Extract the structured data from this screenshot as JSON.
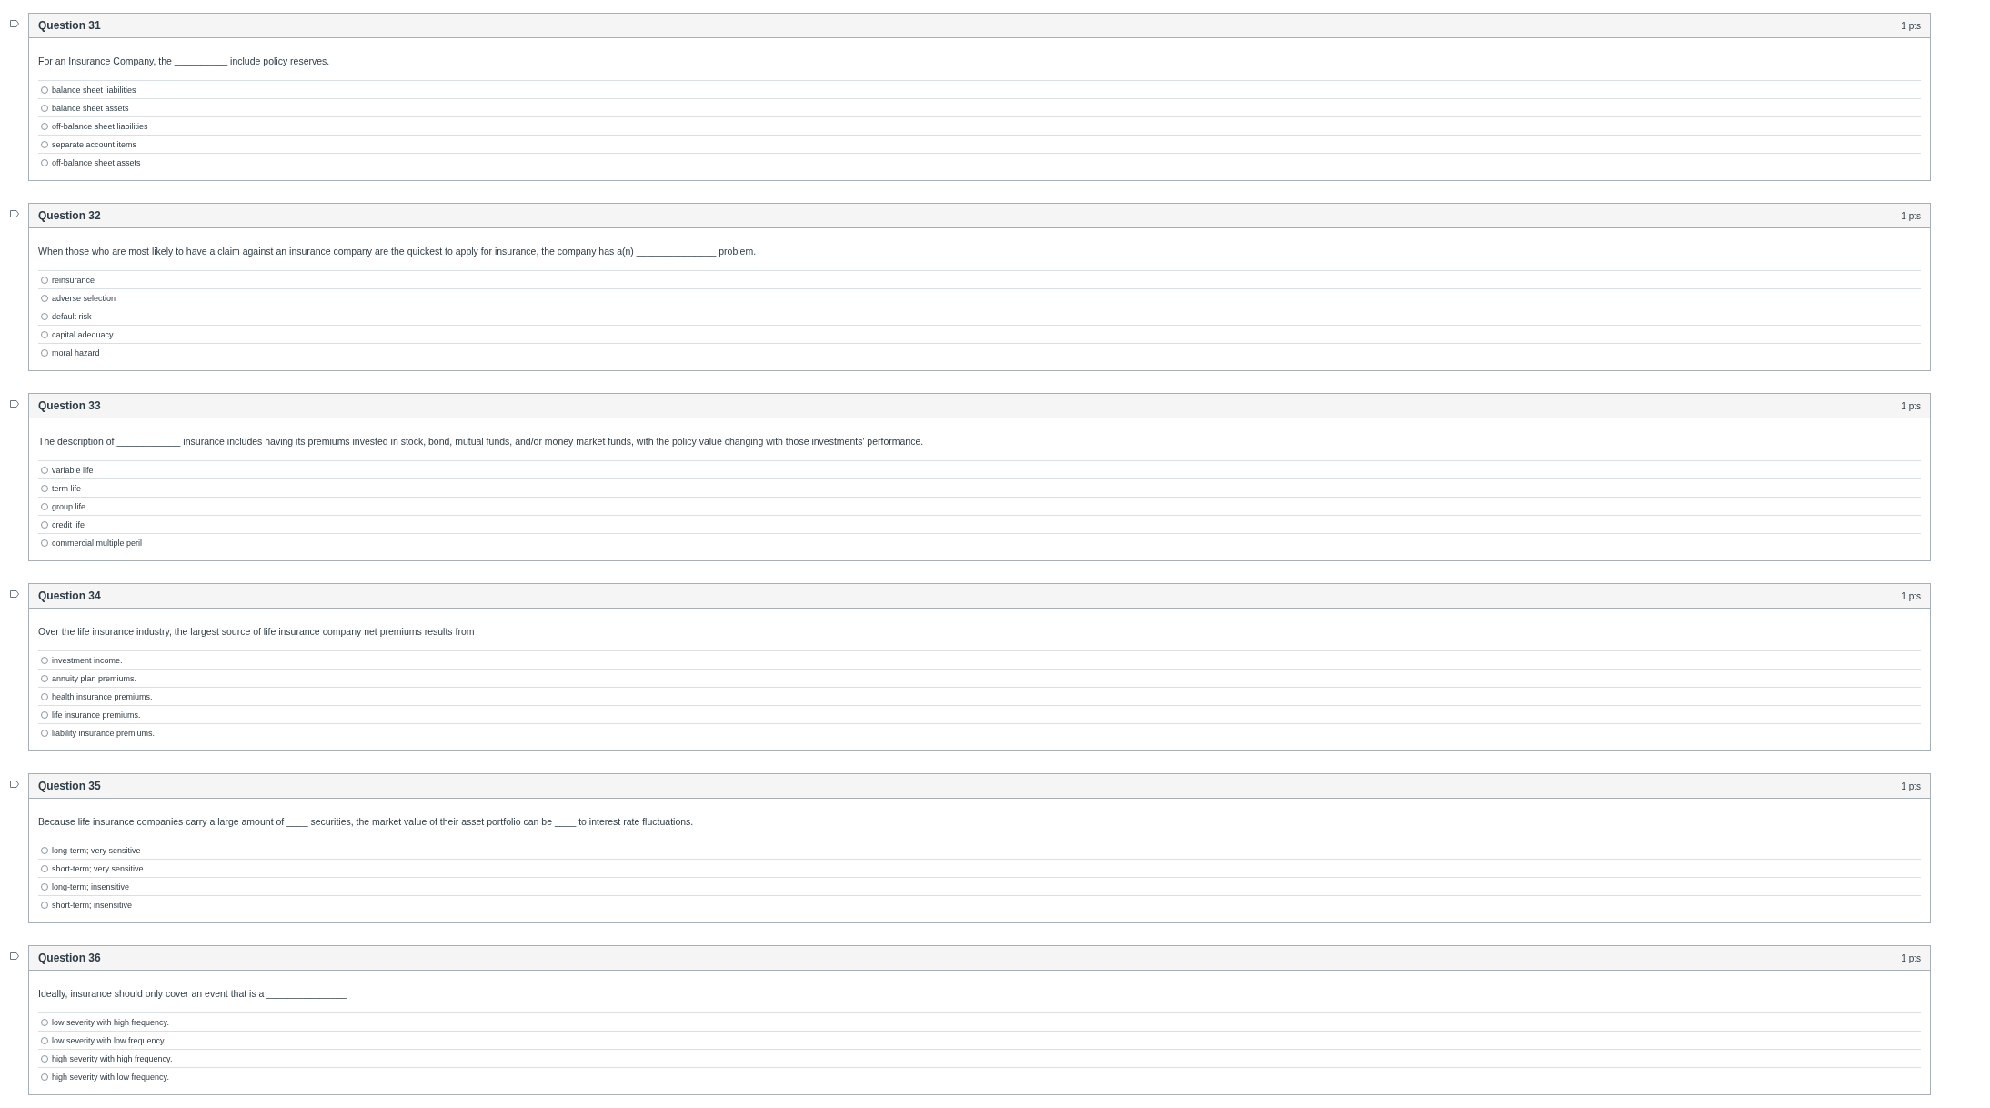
{
  "questions": [
    {
      "title": "Question 31",
      "points": "1 pts",
      "text": "For an Insurance Company, the __________ include policy reserves.",
      "options": [
        {
          "label": "balance sheet liabilities",
          "selected": false
        },
        {
          "label": "balance sheet assets",
          "selected": false
        },
        {
          "label": "off-balance sheet liabilities",
          "selected": false
        },
        {
          "label": "separate account items",
          "selected": false
        },
        {
          "label": "off-balance sheet assets",
          "selected": false
        }
      ]
    },
    {
      "title": "Question 32",
      "points": "1 pts",
      "text": "When those who are most likely to have a claim against an insurance company are the quickest to apply for insurance, the company has a(n) _______________ problem.",
      "options": [
        {
          "label": "reinsurance",
          "selected": false
        },
        {
          "label": "adverse selection",
          "selected": false
        },
        {
          "label": "default risk",
          "selected": false
        },
        {
          "label": "capital adequacy",
          "selected": false
        },
        {
          "label": "moral hazard",
          "selected": false
        }
      ]
    },
    {
      "title": "Question 33",
      "points": "1 pts",
      "text": "The description of ____________ insurance includes having its premiums invested in stock, bond, mutual funds, and/or money market funds, with the policy value changing with those investments' performance.",
      "options": [
        {
          "label": "variable life",
          "selected": false
        },
        {
          "label": "term life",
          "selected": false
        },
        {
          "label": "group life",
          "selected": false
        },
        {
          "label": "credit life",
          "selected": false
        },
        {
          "label": "commercial multiple peril",
          "selected": false
        }
      ]
    },
    {
      "title": "Question 34",
      "points": "1 pts",
      "text": "Over the life insurance industry, the largest source of life insurance company net premiums results from",
      "options": [
        {
          "label": "investment income.",
          "selected": false
        },
        {
          "label": "annuity plan premiums.",
          "selected": false
        },
        {
          "label": "health insurance premiums.",
          "selected": false
        },
        {
          "label": "life insurance premiums.",
          "selected": false
        },
        {
          "label": "liability insurance premiums.",
          "selected": false
        }
      ]
    },
    {
      "title": "Question 35",
      "points": "1 pts",
      "text": "Because life insurance companies carry a large amount of ____ securities, the market value of their asset portfolio can be ____ to interest rate fluctuations.",
      "options": [
        {
          "label": "long-term; very sensitive",
          "selected": false
        },
        {
          "label": "short-term; very sensitive",
          "selected": false
        },
        {
          "label": "long-term; insensitive",
          "selected": false
        },
        {
          "label": "short-term; insensitive",
          "selected": false
        }
      ]
    },
    {
      "title": "Question 36",
      "points": "1 pts",
      "text": "Ideally, insurance should only cover an event that is a _______________",
      "options": [
        {
          "label": "low severity with high frequency.",
          "selected": false
        },
        {
          "label": "low severity with low frequency.",
          "selected": false
        },
        {
          "label": "high severity with high frequency.",
          "selected": false
        },
        {
          "label": "high severity with low frequency.",
          "selected": false
        }
      ]
    }
  ]
}
